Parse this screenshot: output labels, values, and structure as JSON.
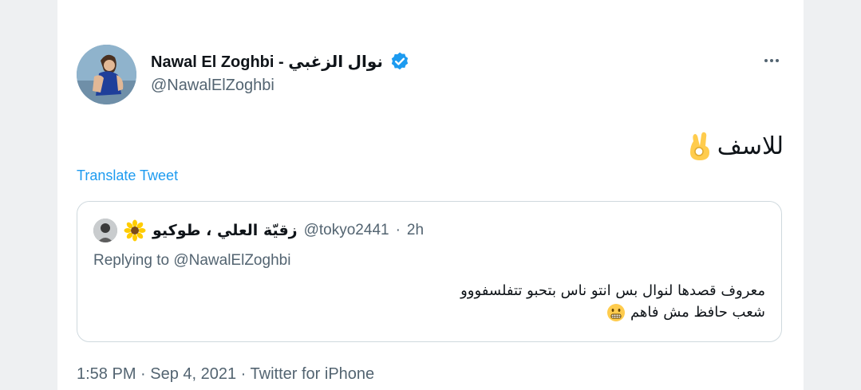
{
  "tweet": {
    "author": {
      "display_name": "Nawal El Zoghbi - نوال الزغبي",
      "handle": "@NawalElZoghbi",
      "verified": true,
      "avatar_icon": "avatar"
    },
    "text": "للاسف",
    "emoji": "ok-hand-icon",
    "translate_label": "Translate Tweet",
    "more_icon": "more-icon"
  },
  "quote": {
    "author_name": "زقيّة العلي ، طوكيو",
    "author_emoji": "sunflower-icon",
    "handle": "@tokyo2441",
    "separator": "·",
    "time": "2h",
    "replying_prefix": "Replying to ",
    "replying_to": "@NawalElZoghbi",
    "line1": "معروف قصدها لنوال بس انتو  ناس بتحبو تتفلسفووو",
    "line2": "شعب حافظ مش فاهم",
    "line2_emoji": "grimace-icon"
  },
  "meta": {
    "text": "1:58 PM · Sep 4, 2021 · Twitter for iPhone"
  },
  "colors": {
    "accent": "#1d9bf0",
    "secondary_text": "#536471",
    "primary_text": "#0f1419",
    "border": "#cfd9de"
  }
}
